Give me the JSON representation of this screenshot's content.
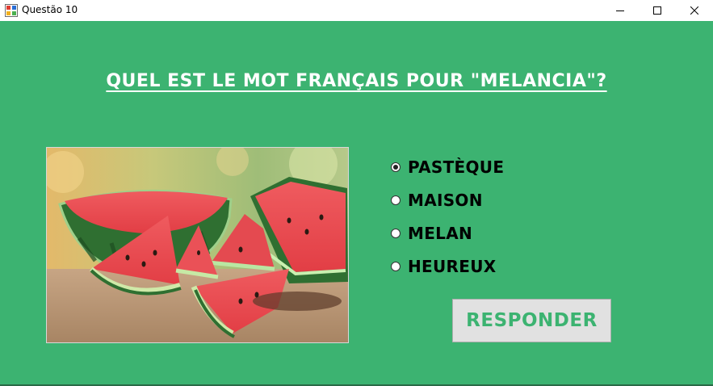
{
  "window": {
    "title": "Questão 10",
    "app_icon": "winforms-app-icon",
    "controls": {
      "minimize": "minimize-icon",
      "maximize": "maximize-icon",
      "close": "close-icon"
    }
  },
  "quiz": {
    "question": "Quel est le mot français pour \"Melancia\"?",
    "image_alt": "watermelon slices",
    "options": [
      {
        "label": "PASTÈQUE",
        "selected": true
      },
      {
        "label": "MAISON",
        "selected": false
      },
      {
        "label": "MELAN",
        "selected": false
      },
      {
        "label": "HEUREUX",
        "selected": false
      }
    ],
    "submit_label": "RESPONDER"
  },
  "colors": {
    "background": "#3cb371",
    "button_bg": "#e1e1e1",
    "button_text": "#3cb371",
    "question_text": "#ffffff"
  }
}
